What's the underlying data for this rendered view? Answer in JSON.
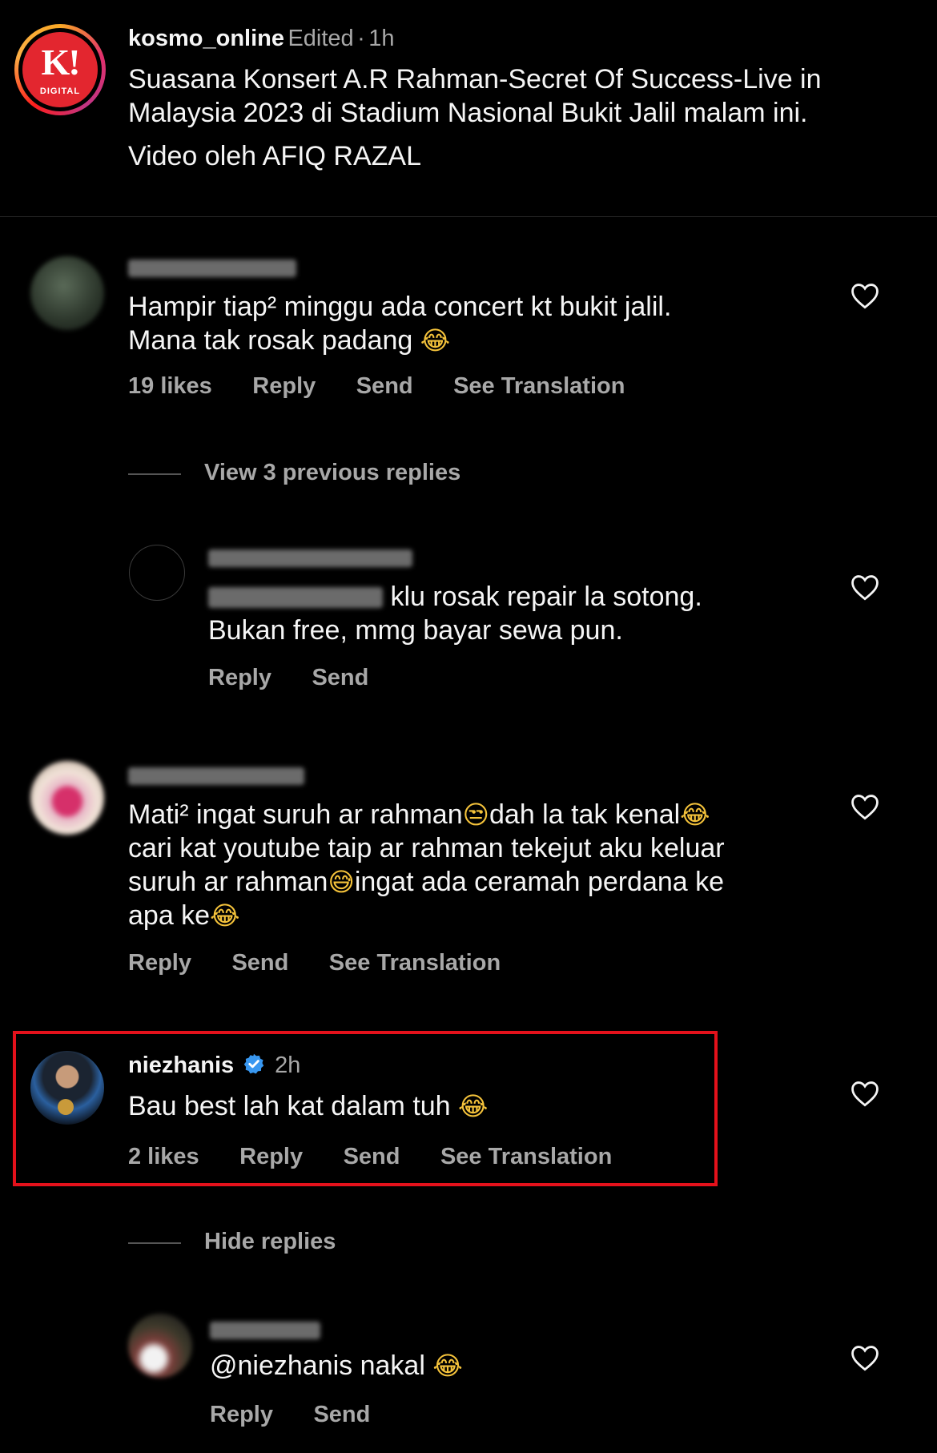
{
  "post": {
    "avatar_text": "K!",
    "avatar_subtext": "DIGITAL",
    "username": "kosmo_online",
    "edited_label": "Edited",
    "time": "1h",
    "caption_line1": "Suasana Konsert A.R Rahman-Secret Of Success-Live in",
    "caption_line2": "Malaysia 2023 di Stadium Nasional Bukit Jalil malam ini.",
    "caption_line3": "Video oleh AFIQ RAZAL"
  },
  "comments": [
    {
      "line1": "Hampir tiap² minggu ada concert kt bukit jalil.",
      "line2": "Mana tak rosak padang",
      "emoji": "😂",
      "likes": "19 likes",
      "reply": "Reply",
      "send": "Send",
      "translate": "See Translation"
    },
    {
      "view_replies": "View 3 previous replies"
    },
    {
      "line1_suffix": "klu rosak repair la sotong.",
      "line2": "Bukan free, mmg bayar sewa pun.",
      "reply": "Reply",
      "send": "Send"
    },
    {
      "line1a": "Mati² ingat suruh ar rahman",
      "emoji1": "😒",
      "line1b": "dah la tak kenal",
      "emoji2": "😂",
      "line2": "cari kat youtube taip ar rahman tekejut aku keluar",
      "line3a": "suruh ar rahman",
      "emoji3": "😅",
      "line3b": "ingat ada ceramah perdana ke",
      "line4": "apa ke",
      "emoji4": "😂",
      "reply": "Reply",
      "send": "Send",
      "translate": "See Translation"
    },
    {
      "username": "niezhanis",
      "time": "2h",
      "text": "Bau best lah kat dalam tuh",
      "emoji": "😂",
      "likes": "2 likes",
      "reply": "Reply",
      "send": "Send",
      "translate": "See Translation"
    },
    {
      "hide_replies": "Hide replies"
    },
    {
      "text": "@niezhanis nakal",
      "emoji": "😂",
      "reply": "Reply",
      "send": "Send"
    }
  ],
  "colors": {
    "background": "#000000",
    "primary_text": "#f5f5f5",
    "secondary_text": "#a8a8a8",
    "verified_blue": "#3897f0",
    "highlight_red": "#e4111b"
  },
  "icons": [
    "heart-icon",
    "verified-badge-icon"
  ]
}
